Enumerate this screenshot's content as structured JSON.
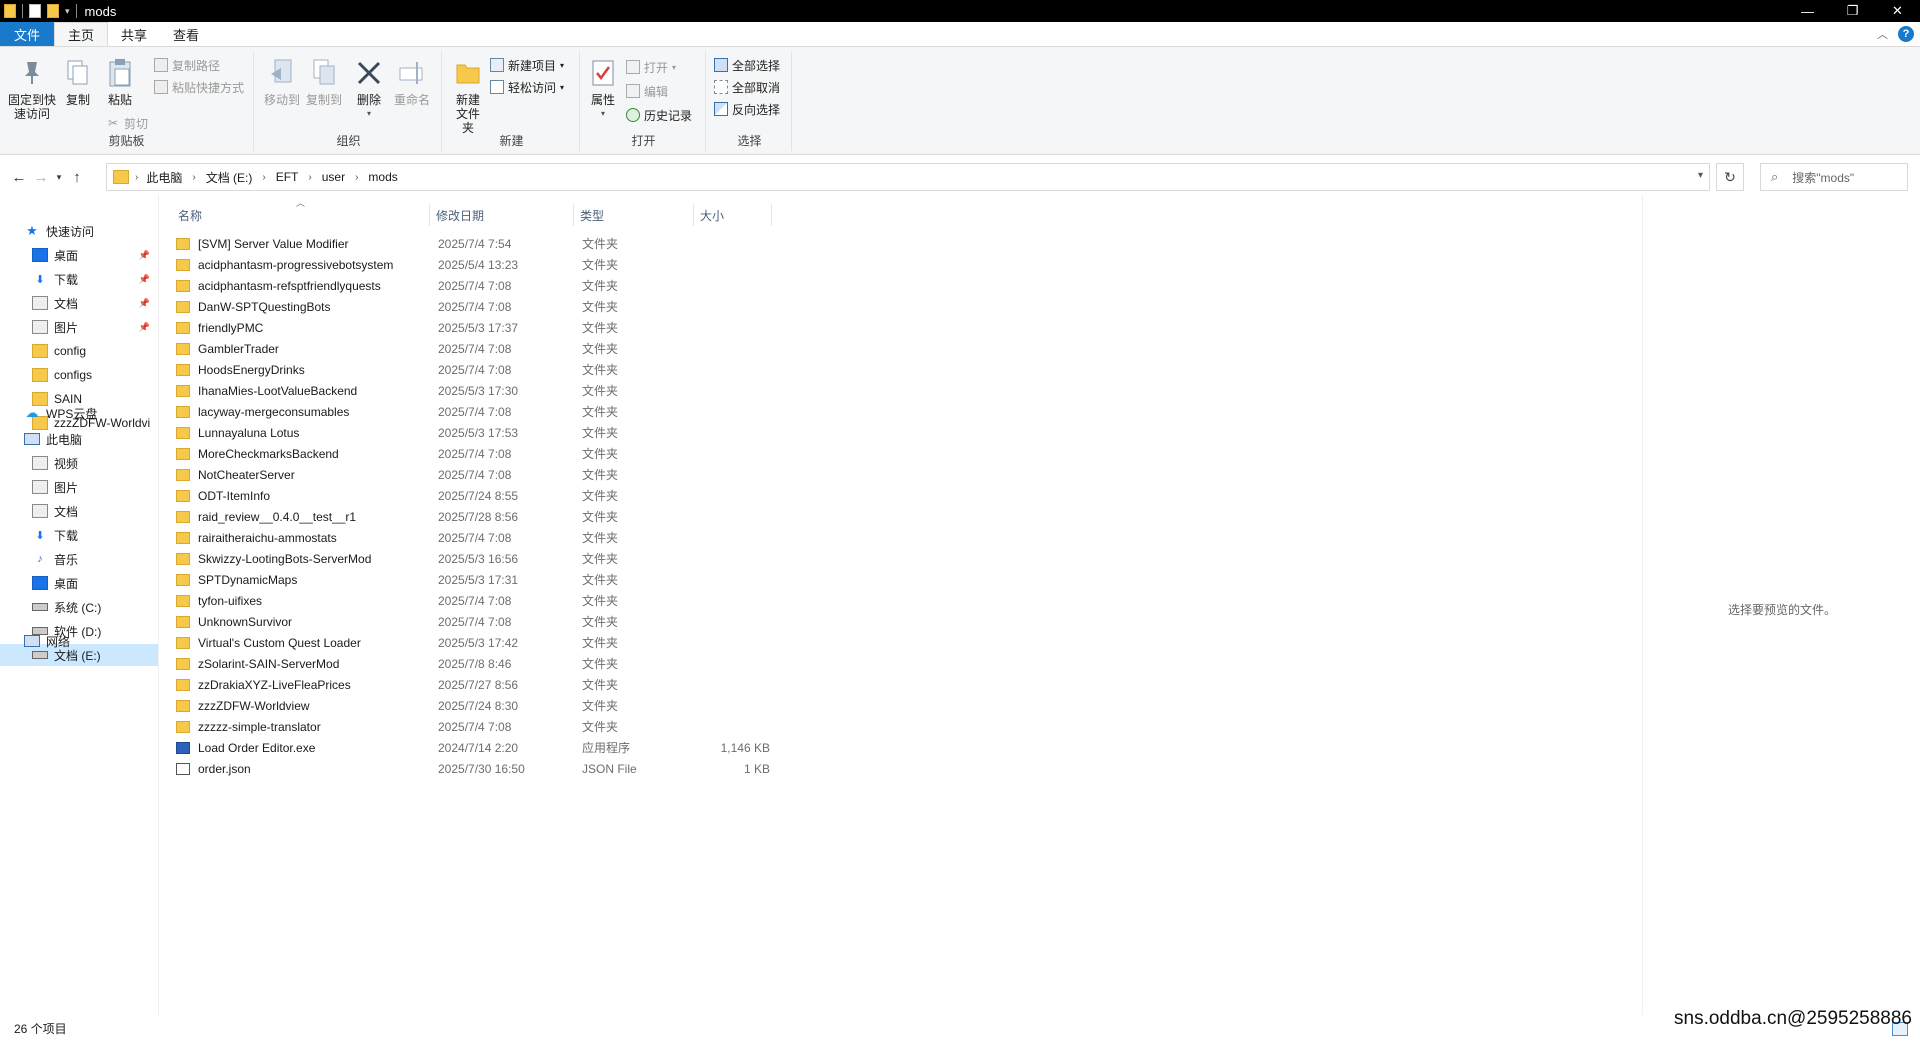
{
  "window": {
    "title": "mods"
  },
  "ribbon_tabs": [
    "文件",
    "主页",
    "共享",
    "查看"
  ],
  "ribbon": {
    "clipboard": {
      "pin_label": "固定到快速访问",
      "copy_label": "复制",
      "paste_label": "粘贴",
      "copy_path_label": "复制路径",
      "paste_shortcut_label": "粘贴快捷方式",
      "cut_label": "剪切",
      "group_label": "剪贴板"
    },
    "organize": {
      "move_to_label": "移动到",
      "copy_to_label": "复制到",
      "delete_label": "删除",
      "rename_label": "重命名",
      "group_label": "组织"
    },
    "new": {
      "new_folder_label": "新建文件夹",
      "new_item_label": "新建项目",
      "easy_access_label": "轻松访问",
      "group_label": "新建"
    },
    "open": {
      "properties_label": "属性",
      "open_label": "打开",
      "edit_label": "编辑",
      "history_label": "历史记录",
      "group_label": "打开"
    },
    "select": {
      "select_all_label": "全部选择",
      "select_none_label": "全部取消",
      "invert_label": "反向选择",
      "group_label": "选择"
    }
  },
  "address": {
    "crumbs": [
      "此电脑",
      "文档 (E:)",
      "EFT",
      "user",
      "mods"
    ],
    "search_placeholder": "搜索\"mods\""
  },
  "nav": {
    "quick_access": "快速访问",
    "quick_items": [
      {
        "label": "桌面",
        "pinned": true
      },
      {
        "label": "下载",
        "pinned": true
      },
      {
        "label": "文档",
        "pinned": true
      },
      {
        "label": "图片",
        "pinned": true
      },
      {
        "label": "config",
        "pinned": false
      },
      {
        "label": "configs",
        "pinned": false
      },
      {
        "label": "SAIN",
        "pinned": false
      },
      {
        "label": "zzzZDFW-Worldvi",
        "pinned": false
      }
    ],
    "wps": "WPS云盘",
    "this_pc": "此电脑",
    "pc_items": [
      "视频",
      "图片",
      "文档",
      "下载",
      "音乐",
      "桌面",
      "系统 (C:)",
      "软件 (D:)",
      "文档 (E:)"
    ],
    "network": "网络"
  },
  "columns": {
    "name": "名称",
    "date": "修改日期",
    "type": "类型",
    "size": "大小"
  },
  "files": [
    {
      "name": "[SVM] Server Value Modifier",
      "date": "2025/7/4 7:54",
      "type": "文件夹",
      "size": "",
      "kind": "folder"
    },
    {
      "name": "acidphantasm-progressivebotsystem",
      "date": "2025/5/4 13:23",
      "type": "文件夹",
      "size": "",
      "kind": "folder"
    },
    {
      "name": "acidphantasm-refsptfriendlyquests",
      "date": "2025/7/4 7:08",
      "type": "文件夹",
      "size": "",
      "kind": "folder"
    },
    {
      "name": "DanW-SPTQuestingBots",
      "date": "2025/7/4 7:08",
      "type": "文件夹",
      "size": "",
      "kind": "folder"
    },
    {
      "name": "friendlyPMC",
      "date": "2025/5/3 17:37",
      "type": "文件夹",
      "size": "",
      "kind": "folder"
    },
    {
      "name": "GamblerTrader",
      "date": "2025/7/4 7:08",
      "type": "文件夹",
      "size": "",
      "kind": "folder"
    },
    {
      "name": "HoodsEnergyDrinks",
      "date": "2025/7/4 7:08",
      "type": "文件夹",
      "size": "",
      "kind": "folder"
    },
    {
      "name": "IhanaMies-LootValueBackend",
      "date": "2025/5/3 17:30",
      "type": "文件夹",
      "size": "",
      "kind": "folder"
    },
    {
      "name": "lacyway-mergeconsumables",
      "date": "2025/7/4 7:08",
      "type": "文件夹",
      "size": "",
      "kind": "folder"
    },
    {
      "name": "Lunnayaluna Lotus",
      "date": "2025/5/3 17:53",
      "type": "文件夹",
      "size": "",
      "kind": "folder"
    },
    {
      "name": "MoreCheckmarksBackend",
      "date": "2025/7/4 7:08",
      "type": "文件夹",
      "size": "",
      "kind": "folder"
    },
    {
      "name": "NotCheaterServer",
      "date": "2025/7/4 7:08",
      "type": "文件夹",
      "size": "",
      "kind": "folder"
    },
    {
      "name": "ODT-ItemInfo",
      "date": "2025/7/24 8:55",
      "type": "文件夹",
      "size": "",
      "kind": "folder"
    },
    {
      "name": "raid_review__0.4.0__test__r1",
      "date": "2025/7/28 8:56",
      "type": "文件夹",
      "size": "",
      "kind": "folder"
    },
    {
      "name": "rairaitheraichu-ammostats",
      "date": "2025/7/4 7:08",
      "type": "文件夹",
      "size": "",
      "kind": "folder"
    },
    {
      "name": "Skwizzy-LootingBots-ServerMod",
      "date": "2025/5/3 16:56",
      "type": "文件夹",
      "size": "",
      "kind": "folder"
    },
    {
      "name": "SPTDynamicMaps",
      "date": "2025/5/3 17:31",
      "type": "文件夹",
      "size": "",
      "kind": "folder"
    },
    {
      "name": "tyfon-uifixes",
      "date": "2025/7/4 7:08",
      "type": "文件夹",
      "size": "",
      "kind": "folder"
    },
    {
      "name": "UnknownSurvivor",
      "date": "2025/7/4 7:08",
      "type": "文件夹",
      "size": "",
      "kind": "folder"
    },
    {
      "name": "Virtual's Custom Quest Loader",
      "date": "2025/5/3 17:42",
      "type": "文件夹",
      "size": "",
      "kind": "folder"
    },
    {
      "name": "zSolarint-SAIN-ServerMod",
      "date": "2025/7/8 8:46",
      "type": "文件夹",
      "size": "",
      "kind": "folder"
    },
    {
      "name": "zzDrakiaXYZ-LiveFleaPrices",
      "date": "2025/7/27 8:56",
      "type": "文件夹",
      "size": "",
      "kind": "folder"
    },
    {
      "name": "zzzZDFW-Worldview",
      "date": "2025/7/24 8:30",
      "type": "文件夹",
      "size": "",
      "kind": "folder"
    },
    {
      "name": "zzzzz-simple-translator",
      "date": "2025/7/4 7:08",
      "type": "文件夹",
      "size": "",
      "kind": "folder"
    },
    {
      "name": "Load Order Editor.exe",
      "date": "2024/7/14 2:20",
      "type": "应用程序",
      "size": "1,146 KB",
      "kind": "exe"
    },
    {
      "name": "order.json",
      "date": "2025/7/30 16:50",
      "type": "JSON File",
      "size": "1 KB",
      "kind": "json"
    }
  ],
  "preview_message": "选择要预览的文件。",
  "status": {
    "item_count": "26 个项目"
  },
  "watermark": "sns.oddba.cn@2595258886",
  "colors": {
    "accent": "#1979ca",
    "folder": "#f6c94b",
    "selected": "#cce8ff"
  }
}
